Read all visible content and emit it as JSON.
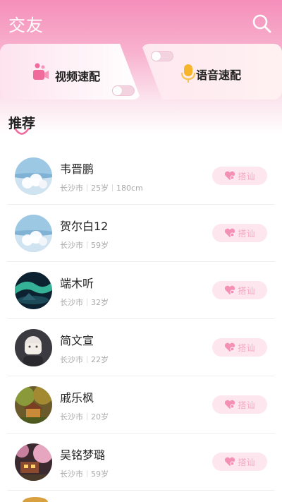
{
  "header": {
    "title": "交友"
  },
  "match": {
    "video_label": "视频速配",
    "voice_label": "语音速配"
  },
  "section": {
    "title": "推荐"
  },
  "colors": {
    "accent": "#f58fba",
    "chat_bg": "#fde6ee",
    "chat_text": "#f6a8c4"
  },
  "users": [
    {
      "name": "韦晋鹏",
      "city": "长沙市",
      "age": "25岁",
      "height": "180cm",
      "chat_label": "搭讪",
      "avatar": "dandelion"
    },
    {
      "name": "贺尔白12",
      "city": "长沙市",
      "age": "59岁",
      "chat_label": "搭讪",
      "avatar": "dandelion"
    },
    {
      "name": "端木听",
      "city": "长沙市",
      "age": "32岁",
      "chat_label": "搭讪",
      "avatar": "aurora"
    },
    {
      "name": "简文宣",
      "city": "长沙市",
      "age": "22岁",
      "chat_label": "搭讪",
      "avatar": "anime-girl"
    },
    {
      "name": "戚乐枫",
      "city": "长沙市",
      "age": "20岁",
      "chat_label": "搭讪",
      "avatar": "forest-house"
    },
    {
      "name": "吴铭梦璐",
      "city": "长沙市",
      "age": "59岁",
      "chat_label": "搭讪",
      "avatar": "blossom-house"
    }
  ]
}
